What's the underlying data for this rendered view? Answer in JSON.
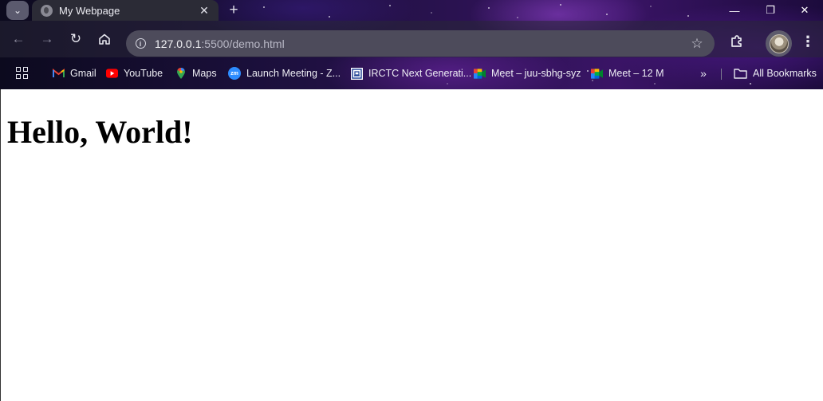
{
  "tab": {
    "title": "My Webpage",
    "close_glyph": "✕",
    "new_tab_glyph": "+",
    "search_glyph": "⌄"
  },
  "window_controls": {
    "minimize_glyph": "—",
    "restore_glyph": "❐",
    "close_glyph": "✕"
  },
  "toolbar": {
    "url_host": "127.0.0.1",
    "url_path": ":5500/demo.html",
    "info_glyph": "i",
    "back_glyph": "←",
    "forward_glyph": "→",
    "reload_glyph": "↻",
    "star_glyph": "☆",
    "menu_glyph": "⋮"
  },
  "bookmarks": {
    "items": [
      {
        "label": "Gmail",
        "icon": "gmail-icon"
      },
      {
        "label": "YouTube",
        "icon": "youtube-icon"
      },
      {
        "label": "Maps",
        "icon": "maps-icon"
      },
      {
        "label": "Launch Meeting - Z...",
        "icon": "zoom-icon"
      },
      {
        "label": "IRCTC Next Generati...",
        "icon": "irctc-icon"
      },
      {
        "label": "Meet – juu-sbhg-syz",
        "icon": "google-meet-icon"
      },
      {
        "label": "Meet – 12 M",
        "icon": "google-meet-icon"
      }
    ],
    "overflow_glyph": "»",
    "all_bookmarks_label": "All Bookmarks",
    "zoom_badge": "zm"
  },
  "page": {
    "heading": "Hello, World!"
  },
  "colors": {
    "gmail_red": "#EA4335",
    "youtube_red": "#FF0000",
    "zoom_blue": "#2D8CFF",
    "page_background": "#ffffff"
  }
}
